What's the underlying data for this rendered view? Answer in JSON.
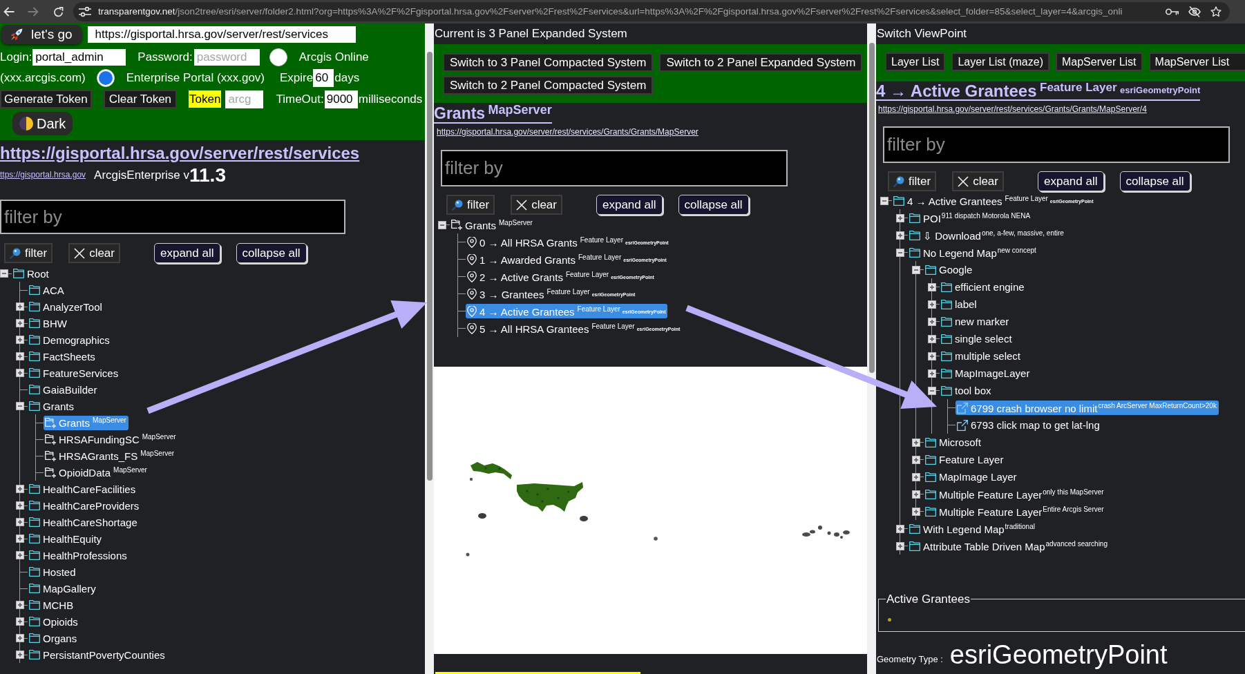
{
  "browser": {
    "url_host": "transparentgov.net",
    "url_path": "/json2tree/esri/server/folder2.html?org=https%3A%2F%2Fgisportal.hrsa.gov%2Fserver%2Frest%2Fservices&url=https%3A%2F%2Fgisportal.hrsa.gov%2Fserver%2Frest%2Fservices&select_folder=85&select_layer=4&arcgis_onli"
  },
  "left_panel": {
    "go_button": "let's go",
    "server_url": "https://gisportal.hrsa.gov/server/rest/services",
    "login": {
      "label": "Login:",
      "value": "portal_admin"
    },
    "password": {
      "label": "Password:",
      "placeholder": "password"
    },
    "portal_options": [
      {
        "label": "Arcgis Online",
        "note": "(xxx.arcgis.com)",
        "selected": false
      },
      {
        "label": "Enterprise Portal (xxx.gov)",
        "selected": true
      }
    ],
    "expire": {
      "label": "Expire",
      "value": "60",
      "unit": "days"
    },
    "generate_button": "Generate Token",
    "clear_token_button": "Clear Token",
    "token": {
      "label": "Token",
      "placeholder": "arcg"
    },
    "timeout": {
      "label": "TimeOut:",
      "value": "9000",
      "unit": "milliseconds"
    },
    "theme_button": "Dark",
    "root_link": "https://gisportal.hrsa.gov/server/rest/services",
    "home_link": "ttps://gisportal.hrsa.gov",
    "product": "ArcgisEnterprise v",
    "version": "11.3",
    "filter": {
      "placeholder": "filter by"
    },
    "tools": [
      {
        "kind": "filter",
        "label": "filter"
      },
      {
        "kind": "clear",
        "label": "clear"
      },
      {
        "kind": "expand",
        "label": "expand all"
      },
      {
        "kind": "collapse",
        "label": "collapse all"
      }
    ],
    "tree": [
      {
        "kind": "folder",
        "label": "Root",
        "expanded": true,
        "selected": false,
        "children": [
          {
            "kind": "folder",
            "label": "ACA",
            "selected": false
          },
          {
            "kind": "folder",
            "label": "AnalyzerTool",
            "expanded": false,
            "selected": false
          },
          {
            "kind": "folder",
            "label": "BHW",
            "expanded": false,
            "selected": false
          },
          {
            "kind": "folder",
            "label": "Demographics",
            "expanded": false,
            "selected": false
          },
          {
            "kind": "folder",
            "label": "FactSheets",
            "expanded": false,
            "selected": false
          },
          {
            "kind": "folder",
            "label": "FeatureServices",
            "expanded": false,
            "selected": false
          },
          {
            "kind": "folder",
            "label": "GaiaBuilder",
            "selected": false
          },
          {
            "kind": "folder",
            "label": "Grants",
            "expanded": true,
            "selected": false,
            "children": [
              {
                "kind": "mapserver",
                "label": "Grants",
                "tag": "MapServer",
                "selected": true
              },
              {
                "kind": "mapserver",
                "label": "HRSAFundingSC",
                "tag": "MapServer",
                "selected": false
              },
              {
                "kind": "mapserver",
                "label": "HRSAGrants_FS",
                "tag": "MapServer",
                "selected": false
              },
              {
                "kind": "mapserver",
                "label": "OpioidData",
                "tag": "MapServer",
                "selected": false
              }
            ]
          },
          {
            "kind": "folder",
            "label": "HealthCareFacilities",
            "expanded": false,
            "selected": false
          },
          {
            "kind": "folder",
            "label": "HealthCareProviders",
            "expanded": false,
            "selected": false
          },
          {
            "kind": "folder",
            "label": "HealthCareShortage",
            "expanded": false,
            "selected": false
          },
          {
            "kind": "folder",
            "label": "HealthEquity",
            "expanded": false,
            "selected": false
          },
          {
            "kind": "folder",
            "label": "HealthProfessions",
            "expanded": false,
            "selected": false
          },
          {
            "kind": "folder",
            "label": "Hosted",
            "selected": false
          },
          {
            "kind": "folder",
            "label": "MapGallery",
            "selected": false
          },
          {
            "kind": "folder",
            "label": "MCHB",
            "expanded": false,
            "selected": false
          },
          {
            "kind": "folder",
            "label": "Opioids",
            "expanded": false,
            "selected": false
          },
          {
            "kind": "folder",
            "label": "Organs",
            "expanded": false,
            "selected": false
          },
          {
            "kind": "folder",
            "label": "PersistantPovertyCounties",
            "expanded": false,
            "selected": false
          }
        ]
      }
    ]
  },
  "middle_panel": {
    "caption": "Current is 3 Panel Expanded System",
    "switch_buttons": [
      "Switch to 3 Panel Compacted System",
      "Switch to 2 Panel Expanded System",
      "Switch to 2 Panel Compacted System"
    ],
    "title": {
      "label": "Grants",
      "tag": "MapServer"
    },
    "url": "https://gisportal.hrsa.gov/server/rest/services/Grants/Grants/MapServer",
    "filter": {
      "placeholder": "filter by"
    },
    "tools": [
      {
        "kind": "filter",
        "label": "filter"
      },
      {
        "kind": "clear",
        "label": "clear"
      },
      {
        "kind": "expand",
        "label": "expand all"
      },
      {
        "kind": "collapse",
        "label": "collapse all"
      }
    ],
    "tree": [
      {
        "kind": "mapserver",
        "label": "Grants",
        "tag": "MapServer",
        "expanded": true,
        "selected": false,
        "children": [
          {
            "kind": "layer",
            "label": "0 → All HRSA Grants",
            "tag": "Feature Layer",
            "geometry": "esriGeometryPoint",
            "selected": false
          },
          {
            "kind": "layer",
            "label": "1 → Awarded Grants",
            "tag": "Feature Layer",
            "geometry": "esriGeometryPoint",
            "selected": false
          },
          {
            "kind": "layer",
            "label": "2 → Active Grants",
            "tag": "Feature Layer",
            "geometry": "esriGeometryPoint",
            "selected": false
          },
          {
            "kind": "layer",
            "label": "3 → Grantees",
            "tag": "Feature Layer",
            "geometry": "esriGeometryPoint",
            "selected": false
          },
          {
            "kind": "layer",
            "label": "4 → Active Grantees",
            "tag": "Feature Layer",
            "geometry": "esriGeometryPoint",
            "selected": true
          },
          {
            "kind": "layer",
            "label": "5 → All HRSA Grantees",
            "tag": "Feature Layer",
            "geometry": "esriGeometryPoint",
            "selected": false
          }
        ]
      }
    ],
    "map": {
      "kind": "points"
    }
  },
  "right_panel": {
    "caption": "Switch ViewPoint",
    "view_buttons": [
      "Layer List",
      "Layer List (maze)",
      "MapServer List",
      "MapServer List"
    ],
    "title": {
      "label": "4 → Active Grantees",
      "tag": "Feature Layer",
      "geometry": "esriGeometryPoint"
    },
    "url": "https://gisportal.hrsa.gov/server/rest/services/Grants/Grants/MapServer/4",
    "filter": {
      "placeholder": "filter by"
    },
    "tools": [
      {
        "kind": "filter",
        "label": "filter"
      },
      {
        "kind": "clear",
        "label": "clear"
      },
      {
        "kind": "expand",
        "label": "expand all"
      },
      {
        "kind": "collapse",
        "label": "collapse all"
      }
    ],
    "tree": [
      {
        "kind": "folder",
        "label": "4 → Active Grantees",
        "tag": "Feature Layer",
        "geometry": "esriGeometryPoint",
        "expanded": true,
        "selected": false,
        "children": [
          {
            "kind": "folder",
            "label": "POI",
            "note": "911 dispatch Motorola NENA",
            "expanded": false,
            "selected": false
          },
          {
            "kind": "folder",
            "label": "⇩ Download",
            "note": "one, a-few, massive, entire",
            "expanded": false,
            "selected": false
          },
          {
            "kind": "folder",
            "label": "No Legend Map",
            "note": "new concept",
            "expanded": true,
            "selected": false,
            "children": [
              {
                "kind": "folder",
                "label": "Google",
                "expanded": true,
                "selected": false,
                "children": [
                  {
                    "kind": "folder",
                    "label": "efficient engine",
                    "expanded": false,
                    "selected": false
                  },
                  {
                    "kind": "folder",
                    "label": "label",
                    "expanded": false,
                    "selected": false
                  },
                  {
                    "kind": "folder",
                    "label": "new marker",
                    "expanded": false,
                    "selected": false
                  },
                  {
                    "kind": "folder",
                    "label": "single select",
                    "expanded": false,
                    "selected": false
                  },
                  {
                    "kind": "folder",
                    "label": "multiple select",
                    "expanded": false,
                    "selected": false
                  },
                  {
                    "kind": "folder",
                    "label": "MapImageLayer",
                    "expanded": false,
                    "selected": false
                  },
                  {
                    "kind": "folder",
                    "label": "tool box",
                    "expanded": true,
                    "selected": false,
                    "children": [
                      {
                        "kind": "link",
                        "label": "6799 crash browser no limit",
                        "note": "crash ArcServer MaxReturnCount>20k",
                        "selected": true
                      },
                      {
                        "kind": "link",
                        "label": "6793 click map to get lat-lng",
                        "selected": false
                      }
                    ]
                  }
                ]
              },
              {
                "kind": "folder",
                "label": "Microsoft",
                "expanded": false,
                "selected": false
              },
              {
                "kind": "folder",
                "label": "Feature Layer",
                "expanded": false,
                "selected": false
              },
              {
                "kind": "folder",
                "label": "MapImage Layer",
                "expanded": false,
                "selected": false
              },
              {
                "kind": "folder",
                "label": "Multiple Feature Layer",
                "note": "only this MapServer",
                "expanded": false,
                "selected": false
              },
              {
                "kind": "folder",
                "label": "Multiple Feature Layer",
                "note": "Entire Arcgis Server",
                "expanded": false,
                "selected": false
              }
            ]
          },
          {
            "kind": "folder",
            "label": "With Legend Map",
            "note": "traditional",
            "expanded": false,
            "selected": false
          },
          {
            "kind": "folder",
            "label": "Attribute Table Driven Map",
            "note": "advanced searching",
            "expanded": false,
            "selected": false
          }
        ]
      }
    ],
    "legend": {
      "title": "Active Grantees"
    },
    "geometry_label": "Geometry Type :",
    "geometry_value": "esriGeometryPoint"
  },
  "annotations": [
    {
      "kind": "arrow"
    },
    {
      "kind": "arrow"
    }
  ]
}
